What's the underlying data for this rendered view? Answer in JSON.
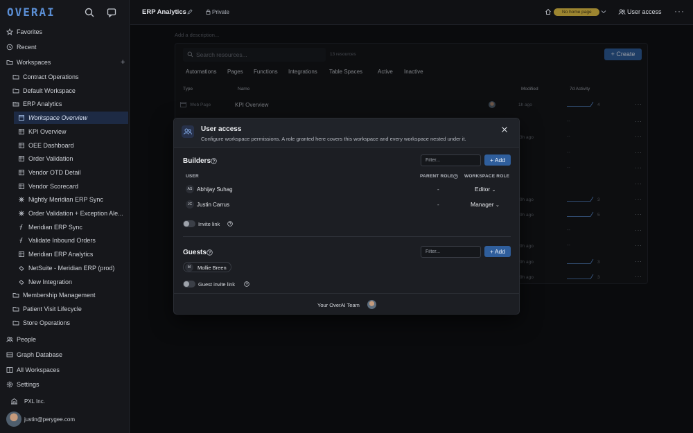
{
  "app": {
    "logo": "OVERAI"
  },
  "sidebar": {
    "favorites": "Favorites",
    "recent": "Recent",
    "workspaces": "Workspaces",
    "items": [
      {
        "label": "Contract Operations",
        "icon": "folder-icon"
      },
      {
        "label": "Default Workspace",
        "icon": "folder-icon"
      },
      {
        "label": "ERP Analytics",
        "icon": "folder-open-icon"
      },
      {
        "label": "Workspace Overview",
        "icon": "page-icon",
        "active": true
      },
      {
        "label": "KPI Overview",
        "icon": "table-icon"
      },
      {
        "label": "OEE Dashboard",
        "icon": "table-icon"
      },
      {
        "label": "Order Validation",
        "icon": "table-icon"
      },
      {
        "label": "Vendor OTD Detail",
        "icon": "table-icon"
      },
      {
        "label": "Vendor Scorecard",
        "icon": "table-icon"
      },
      {
        "label": "Nightly Meridian ERP Sync",
        "icon": "automation-icon"
      },
      {
        "label": "Order Validation + Exception Ale...",
        "icon": "automation-icon"
      },
      {
        "label": "Meridian ERP Sync",
        "icon": "function-icon"
      },
      {
        "label": "Validate Inbound Orders",
        "icon": "function-icon"
      },
      {
        "label": "Meridian ERP Analytics",
        "icon": "table-icon"
      },
      {
        "label": "NetSuite - Meridian ERP (prod)",
        "icon": "integration-icon"
      },
      {
        "label": "New Integration",
        "icon": "integration-icon"
      },
      {
        "label": "Membership Management",
        "icon": "folder-icon"
      },
      {
        "label": "Patient Visit Lifecycle",
        "icon": "folder-icon"
      },
      {
        "label": "Store Operations",
        "icon": "folder-icon"
      }
    ],
    "people": "People",
    "graph_database": "Graph Database",
    "all_workspaces": "All Workspaces",
    "settings": "Settings",
    "org": "PXL Inc.",
    "user_email": "justin@perygee.com"
  },
  "topbar": {
    "title": "ERP Analytics",
    "privacy": "Private",
    "home_badge": "No home page",
    "user_access": "User access"
  },
  "page": {
    "description_placeholder": "Add a description...",
    "search_placeholder": "Search resources...",
    "count": "13 resources",
    "create": "Create",
    "tabs": [
      "Automations",
      "Pages",
      "Functions",
      "Integrations",
      "Table Spaces",
      "Active",
      "Inactive"
    ],
    "columns": {
      "type": "Type",
      "name": "Name",
      "modified": "Modified",
      "activity": "7d Activity"
    },
    "first_row": {
      "type": "Web Page",
      "name": "KPI Overview",
      "modified": "1h ago",
      "activity": "4"
    },
    "rows": [
      {
        "modified": "",
        "activity": "--"
      },
      {
        "modified": "3h ago",
        "activity": "--"
      },
      {
        "modified": "",
        "activity": "--"
      },
      {
        "modified": "",
        "activity": "--"
      },
      {
        "modified": "",
        "activity": ""
      },
      {
        "modified": "9h ago",
        "activity": "3"
      },
      {
        "modified": "9h ago",
        "activity": "5"
      },
      {
        "modified": "",
        "activity": "--"
      },
      {
        "modified": "9h ago",
        "activity": "--"
      },
      {
        "modified": "9h ago",
        "activity": "3"
      },
      {
        "modified": "9h ago",
        "activity": "3"
      }
    ]
  },
  "modal": {
    "title": "User access",
    "subtitle": "Configure workspace permissions. A role granted here covers this workspace and every workspace nested under it.",
    "builders": {
      "title": "Builders",
      "filter_placeholder": "Filter...",
      "add": "+ Add",
      "col_user": "USER",
      "col_parent_role": "PARENT ROLE",
      "col_workspace_role": "WORKSPACE ROLE",
      "users": [
        {
          "initials": "AS",
          "name": "Abhijay Suhag",
          "parent_role": "-",
          "role": "Editor"
        },
        {
          "initials": "JC",
          "name": "Justin Carrus",
          "parent_role": "-",
          "role": "Manager"
        }
      ],
      "invite_link": "Invite link"
    },
    "guests": {
      "title": "Guests",
      "filter_placeholder": "Filter...",
      "add": "+ Add",
      "guest": {
        "initials": "M",
        "name": "Mollie Breen"
      },
      "invite_link": "Guest invite link"
    },
    "footer": "Your OverAI Team"
  }
}
